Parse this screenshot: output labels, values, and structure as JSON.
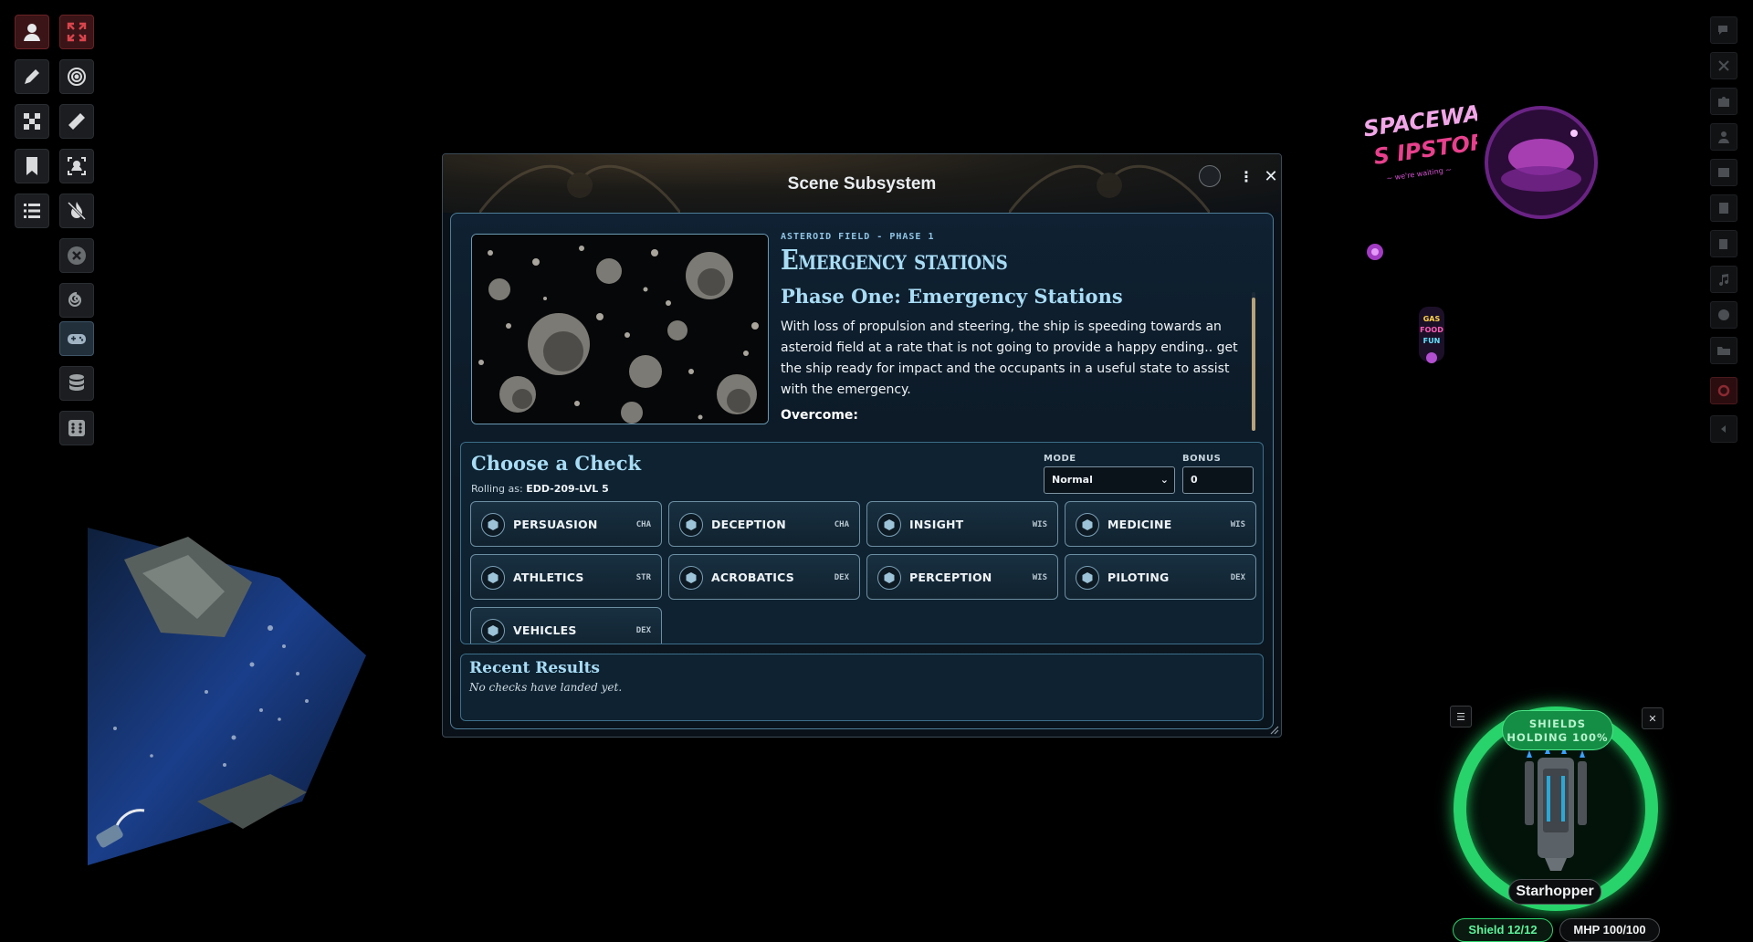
{
  "window": {
    "title": "Scene Subsystem"
  },
  "scene": {
    "kicker": "ASTEROID FIELD - PHASE 1",
    "title": "Emergency stations",
    "heading": "Phase One: Emergency Stations",
    "description": "With loss of propulsion and steering, the ship is speeding towards an asteroid field at a rate that is not going to provide a happy ending.. get the ship ready for impact and the occupants in a useful state to assist with the emergency.",
    "overcome_label": "Overcome:"
  },
  "check": {
    "title": "Choose a Check",
    "rolling_label": "Rolling as:",
    "rolling_actor": "EDD-209-LVL 5",
    "mode_label": "MODE",
    "mode_value": "Normal",
    "bonus_label": "BONUS",
    "bonus_value": "0",
    "skills": [
      {
        "name": "PERSUASION",
        "ability": "CHA"
      },
      {
        "name": "DECEPTION",
        "ability": "CHA"
      },
      {
        "name": "INSIGHT",
        "ability": "WIS"
      },
      {
        "name": "MEDICINE",
        "ability": "WIS"
      },
      {
        "name": "ATHLETICS",
        "ability": "STR"
      },
      {
        "name": "ACROBATICS",
        "ability": "DEX"
      },
      {
        "name": "PERCEPTION",
        "ability": "WIS"
      },
      {
        "name": "PILOTING",
        "ability": "DEX"
      },
      {
        "name": "VEHICLES",
        "ability": "DEX"
      }
    ]
  },
  "recent": {
    "title": "Recent Results",
    "empty_text": "No checks have landed yet."
  },
  "hud": {
    "shield_status_line1": "SHIELDS",
    "shield_status_line2": "HOLDING 100%",
    "ship_name": "Starhopper",
    "shield_stat": "Shield 12/12",
    "mhp_stat": "MHP 100/100",
    "shield_fraction": 1.0
  },
  "map_sign": {
    "line1": "SPACEWAY",
    "line2": "S IPSTOP",
    "small_sign": "GAS FOOD FUN"
  },
  "colors": {
    "accent": "#a8dcf5",
    "shield_green": "#27d36a",
    "active_tool": "#3a1417"
  },
  "left_tools": [
    "token-controls",
    "fullscreen",
    "drawing",
    "target",
    "dice",
    "ruler",
    "journal-notes",
    "region",
    "list",
    "fog-off",
    "clear",
    "spiral",
    "gamepad",
    "database",
    "dice-tray"
  ],
  "right_tabs": [
    "chat",
    "combat",
    "puzzle",
    "actors",
    "items",
    "journal",
    "tables",
    "cards",
    "playlists",
    "compendium",
    "folder",
    "cog",
    "collapse"
  ]
}
